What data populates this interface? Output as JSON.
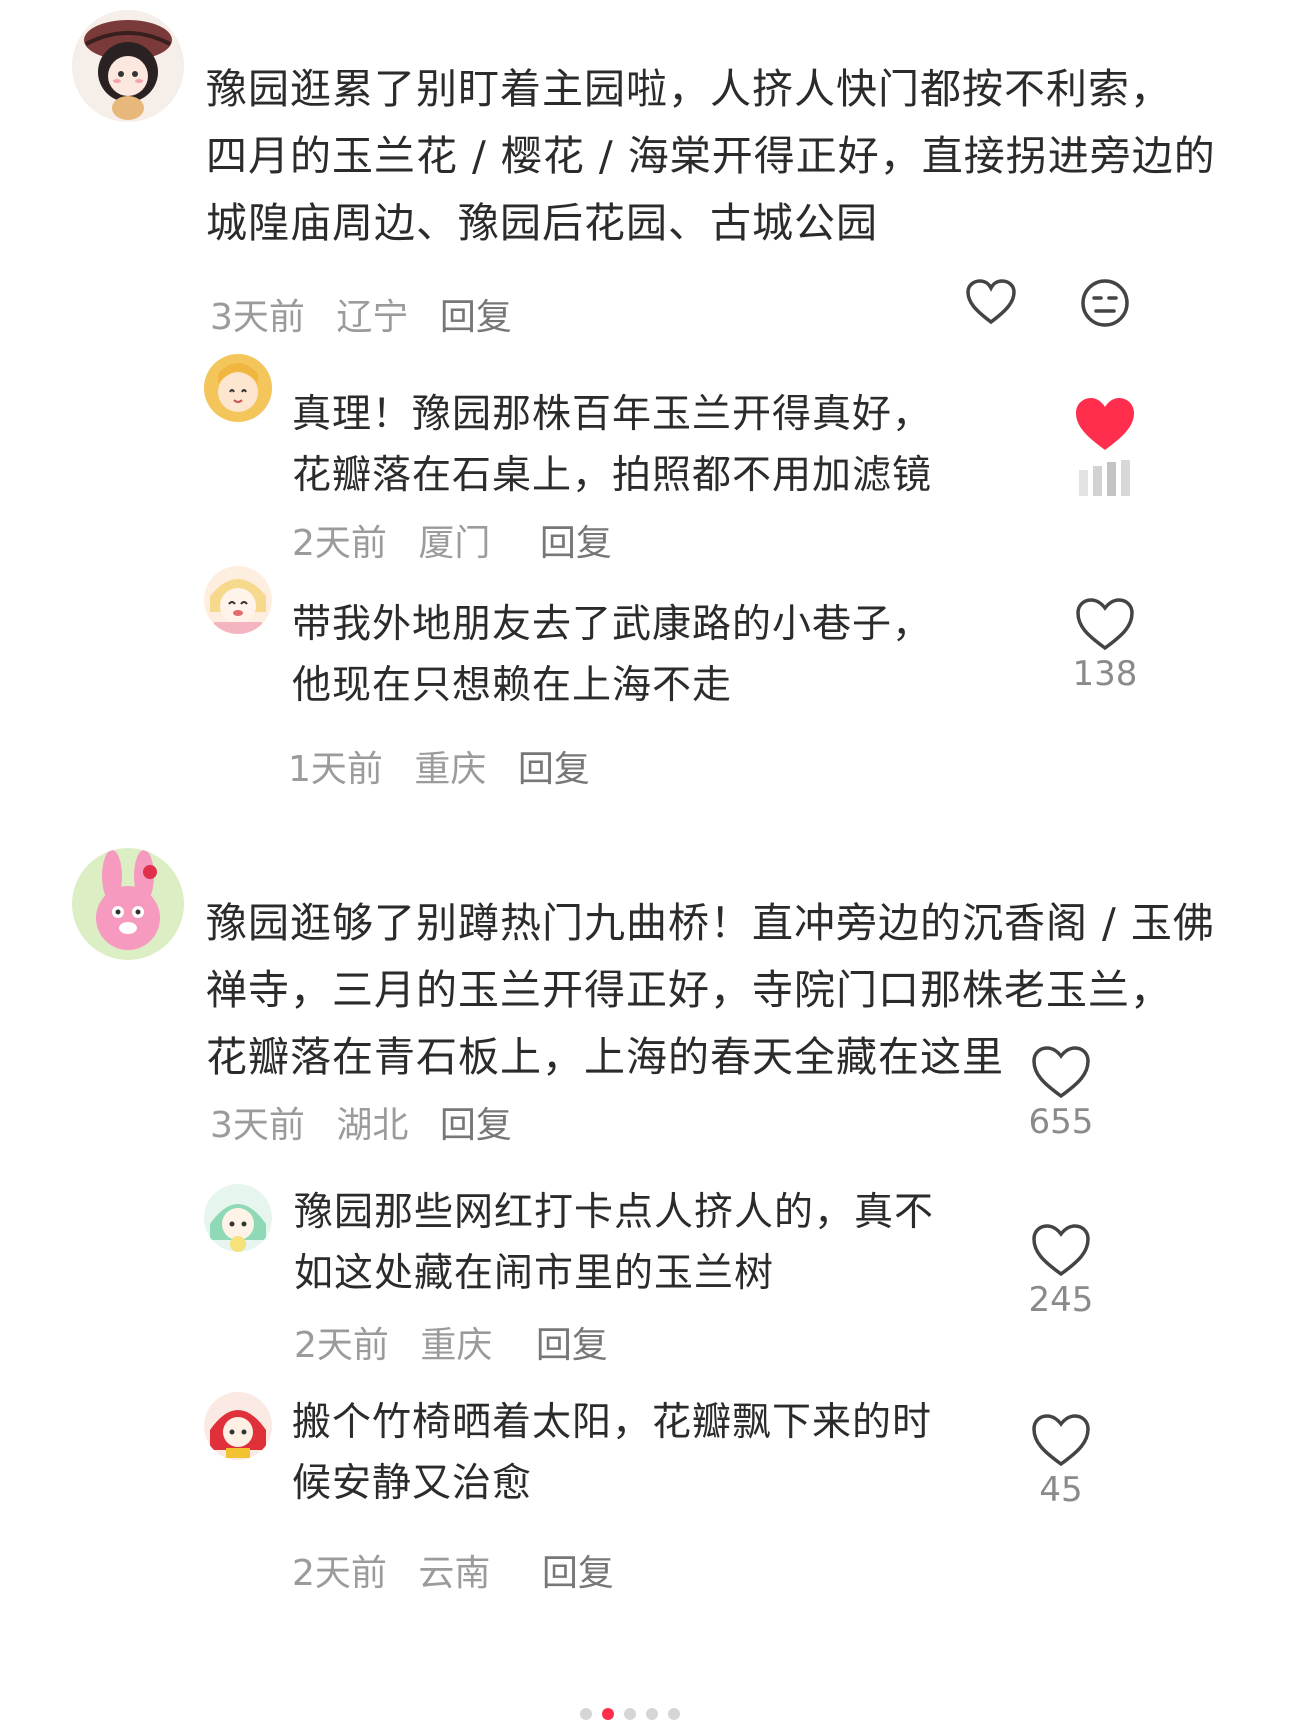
{
  "colors": {
    "accent": "#ff2e4d",
    "meta": "#9b9b9b",
    "text": "#2b2b2b"
  },
  "comments": [
    {
      "lines": [
        "豫园逛累了别盯着主园啦，人挤人快门都按不利索，",
        "四月的玉兰花 / 樱花 / 海棠开得正好，直接拐进旁边的",
        "城隍庙周边、豫园后花园、古城公园"
      ],
      "time": "3天前",
      "location": "辽宁",
      "reply": "回复",
      "like_icon": "heart-outline-icon",
      "dislike_icon": "meh-face-icon",
      "replies": [
        {
          "lines": [
            "真理！豫园那株百年玉兰开得真好，",
            "花瓣落在石桌上，拍照都不用加滤镜"
          ],
          "time": "2天前",
          "location": "厦门",
          "reply": "回复",
          "liked": true,
          "like_icon": "heart-filled-icon"
        },
        {
          "lines": [
            "带我外地朋友去了武康路的小巷子，",
            "他现在只想赖在上海不走"
          ],
          "time": "1天前",
          "location": "重庆",
          "reply": "回复",
          "likes": "138",
          "like_icon": "heart-outline-icon"
        }
      ]
    },
    {
      "lines": [
        "豫园逛够了别蹲热门九曲桥！直冲旁边的沉香阁 / 玉佛",
        "禅寺，三月的玉兰开得正好，寺院门口那株老玉兰，",
        "花瓣落在青石板上，上海的春天全藏在这里"
      ],
      "time": "3天前",
      "location": "湖北",
      "reply": "回复",
      "likes": "655",
      "like_icon": "heart-outline-icon",
      "replies": [
        {
          "lines": [
            "豫园那些网红打卡点人挤人的，真不",
            "如这处藏在闹市里的玉兰树"
          ],
          "time": "2天前",
          "location": "重庆",
          "reply": "回复",
          "likes": "245",
          "like_icon": "heart-outline-icon"
        },
        {
          "lines": [
            "搬个竹椅晒着太阳，花瓣飘下来的时",
            "候安静又治愈"
          ],
          "time": "2天前",
          "location": "云南",
          "reply": "回复",
          "likes": "45",
          "like_icon": "heart-outline-icon"
        }
      ]
    }
  ],
  "pagination": {
    "count": 5,
    "active": 1
  }
}
